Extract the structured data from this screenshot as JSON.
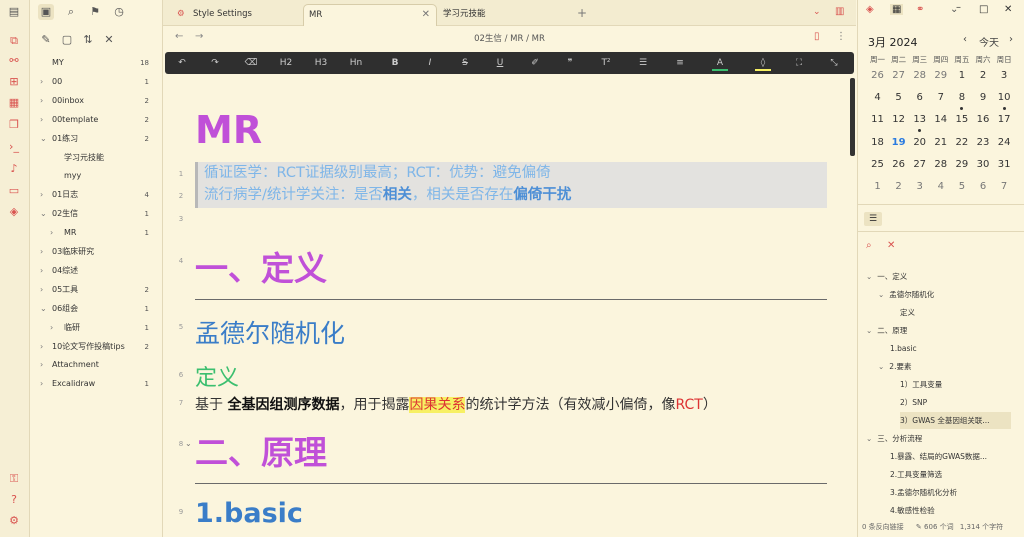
{
  "tabs": [
    {
      "label": "Style Settings",
      "active": false
    },
    {
      "label": "MR",
      "active": true
    },
    {
      "label": "学习元技能",
      "active": false
    }
  ],
  "breadcrumb": "02生信 / MR / MR",
  "file_tree": [
    {
      "label": "MY",
      "count": "18",
      "level": 0,
      "chev": ""
    },
    {
      "label": "00",
      "count": "1",
      "level": 0,
      "chev": "›"
    },
    {
      "label": "00inbox",
      "count": "2",
      "level": 0,
      "chev": "›"
    },
    {
      "label": "00template",
      "count": "2",
      "level": 0,
      "chev": "›"
    },
    {
      "label": "01练习",
      "count": "2",
      "level": 0,
      "chev": "⌄"
    },
    {
      "label": "学习元技能",
      "count": "",
      "level": 1,
      "chev": ""
    },
    {
      "label": "myy",
      "count": "",
      "level": 1,
      "chev": ""
    },
    {
      "label": "01日志",
      "count": "4",
      "level": 0,
      "chev": "›"
    },
    {
      "label": "02生信",
      "count": "1",
      "level": 0,
      "chev": "⌄"
    },
    {
      "label": "MR",
      "count": "1",
      "level": 1,
      "chev": "›"
    },
    {
      "label": "03临床研究",
      "count": "",
      "level": 0,
      "chev": "›"
    },
    {
      "label": "04综述",
      "count": "",
      "level": 0,
      "chev": "›"
    },
    {
      "label": "05工具",
      "count": "2",
      "level": 0,
      "chev": "›"
    },
    {
      "label": "06组会",
      "count": "1",
      "level": 0,
      "chev": "⌄"
    },
    {
      "label": "临研",
      "count": "1",
      "level": 1,
      "chev": "›"
    },
    {
      "label": "10论文写作投稿tips",
      "count": "2",
      "level": 0,
      "chev": "›"
    },
    {
      "label": "Attachment",
      "count": "",
      "level": 0,
      "chev": "›"
    },
    {
      "label": "Excalidraw",
      "count": "1",
      "level": 0,
      "chev": "›"
    }
  ],
  "doc": {
    "title": "MR",
    "quote1": "循证医学：RCT证据级别最高；RCT：优势：避免偏倚",
    "quote2a": "流行病学/统计学关注：是否",
    "quote2b": "相关",
    "quote2c": "，相关是否存在",
    "quote2d": "偏倚干扰",
    "h1_def": "一、定义",
    "h2_mendel": "孟德尔随机化",
    "h3_def": "定义",
    "para_a": "基于 ",
    "para_b": "全基因组测序数据",
    "para_c": "，用于揭露",
    "para_d": "因果关系",
    "para_e": "的统计学方法（有效减小偏倚，像",
    "para_f": "RCT",
    "para_g": "）",
    "h1_principle": "二、原理",
    "h2_basic": "1.basic",
    "line_numbers": [
      "1",
      "2",
      "3",
      "4",
      "5",
      "6",
      "7",
      "8",
      "9"
    ]
  },
  "calendar": {
    "title": "3月 2024",
    "today_label": "今天",
    "weekdays": [
      "周一",
      "周二",
      "周三",
      "周四",
      "周五",
      "周六",
      "周日"
    ],
    "rows": [
      [
        "26",
        "27",
        "28",
        "29",
        "1",
        "2",
        "3"
      ],
      [
        "4",
        "5",
        "6",
        "7",
        "8",
        "9",
        "10"
      ],
      [
        "11",
        "12",
        "13",
        "14",
        "15",
        "16",
        "17"
      ],
      [
        "18",
        "19",
        "20",
        "21",
        "22",
        "23",
        "24"
      ],
      [
        "25",
        "26",
        "27",
        "28",
        "29",
        "30",
        "31"
      ],
      [
        "1",
        "2",
        "3",
        "4",
        "5",
        "6",
        "7"
      ]
    ],
    "today": "19"
  },
  "outline": [
    {
      "label": "一、定义",
      "level": 0,
      "chev": "⌄"
    },
    {
      "label": "孟德尔随机化",
      "level": 1,
      "chev": "⌄"
    },
    {
      "label": "定义",
      "level": 2,
      "chev": ""
    },
    {
      "label": "二、原理",
      "level": 0,
      "chev": "⌄"
    },
    {
      "label": "1.basic",
      "level": 1,
      "chev": ""
    },
    {
      "label": "2.要素",
      "level": 1,
      "chev": "⌄"
    },
    {
      "label": "1）工具变量",
      "level": 2,
      "chev": ""
    },
    {
      "label": "2）SNP",
      "level": 2,
      "chev": ""
    },
    {
      "label": "3）GWAS 全基因组关联...",
      "level": 2,
      "chev": "",
      "selected": true
    },
    {
      "label": "三、分析流程",
      "level": 0,
      "chev": "⌄"
    },
    {
      "label": "1.暴露、结局的GWAS数据...",
      "level": 1,
      "chev": ""
    },
    {
      "label": "2.工具变量筛选",
      "level": 1,
      "chev": ""
    },
    {
      "label": "3.孟德尔随机化分析",
      "level": 1,
      "chev": ""
    },
    {
      "label": "4.敏感性检验",
      "level": 1,
      "chev": ""
    }
  ],
  "status": {
    "backlinks": "0 条反向链接",
    "words": "606 个词",
    "chars": "1,314 个字符"
  },
  "colors": {
    "accent": "#d9534f",
    "heading1": "#c050d8",
    "heading2": "#3a7dc8",
    "heading3": "#3bbf6f",
    "background": "#fbf5dd"
  }
}
